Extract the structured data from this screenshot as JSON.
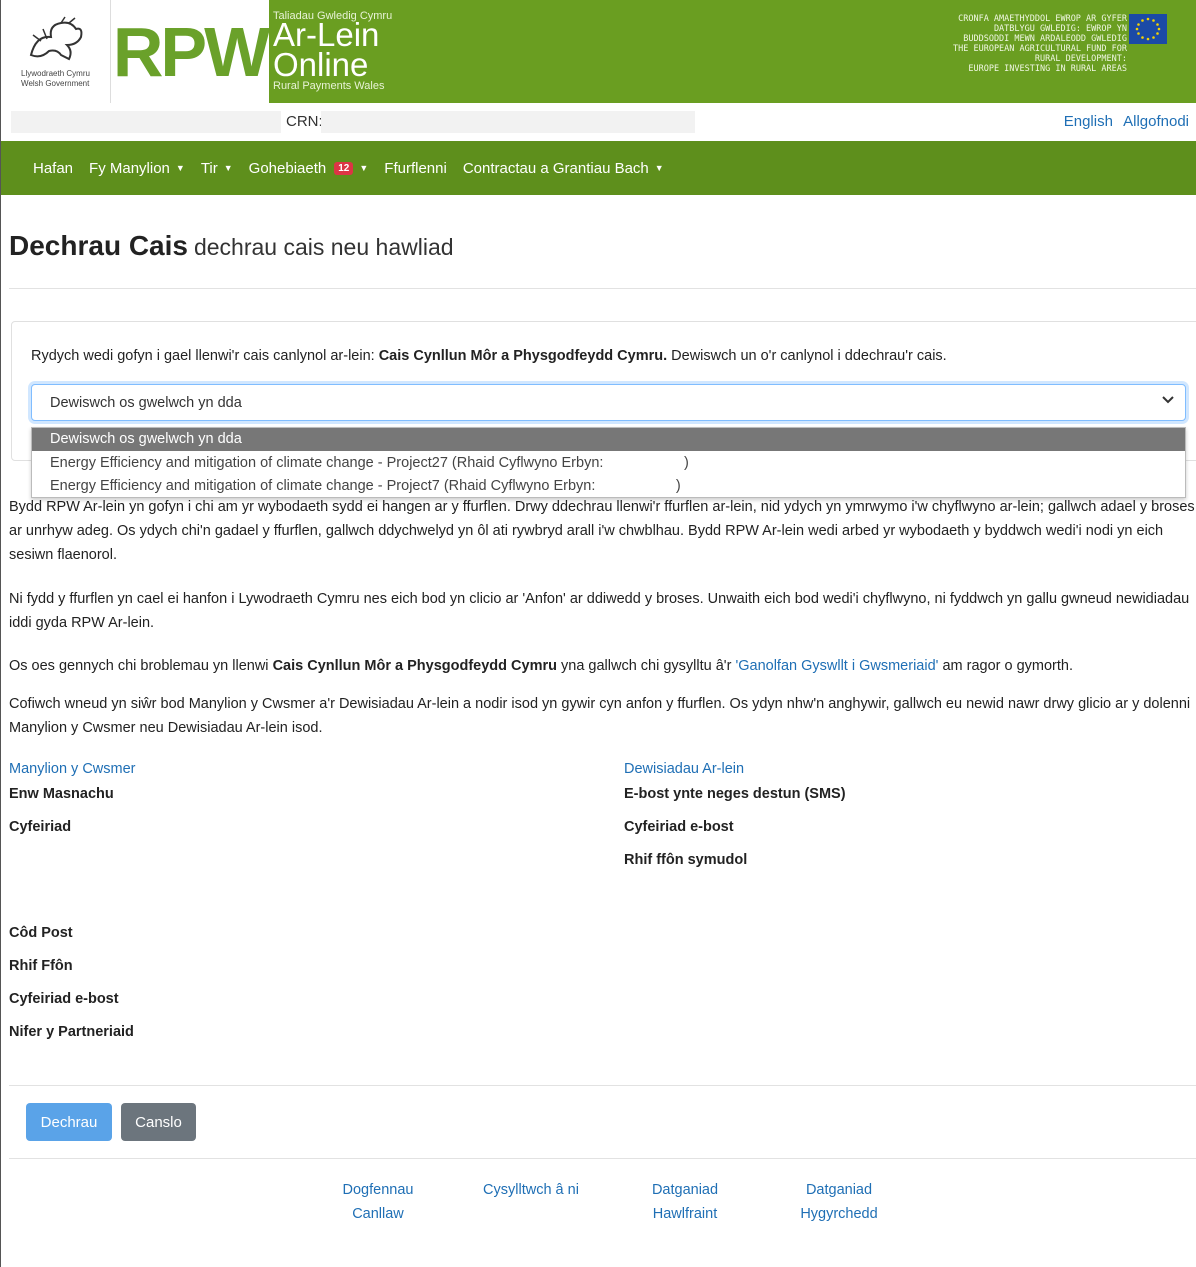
{
  "header": {
    "gov_line1": "Llywodraeth Cymru",
    "gov_line2": "Welsh Government",
    "rpw": "RPW",
    "arlein_small": "Taliadau Gwledig Cymru",
    "arlein_line1": "Ar-Lein",
    "arlein_line2": "Online",
    "arlein_sub": "Rural Payments Wales",
    "eu_text": [
      "CRONFA AMAETHYDDOL EWROP AR GYFER",
      "DATBLYGU GWLEDIG: EWROP YN",
      "BUDDSODDI MEWN ARDALEODD GWLEDIG",
      "THE EUROPEAN AGRICULTURAL FUND FOR",
      "RURAL DEVELOPMENT:",
      "EUROPE INVESTING IN RURAL AREAS"
    ]
  },
  "crn": {
    "label": "CRN:"
  },
  "top_links": {
    "english": "English",
    "logout": "Allgofnodi"
  },
  "nav": {
    "home": "Hafan",
    "my_details": "Fy Manylion",
    "land": "Tir",
    "correspondence": "Gohebiaeth",
    "correspondence_count": "12",
    "forms": "Ffurflenni",
    "contracts": "Contractau a Grantiau Bach"
  },
  "title": {
    "main": "Dechrau Cais",
    "sub": "dechrau cais neu hawliad"
  },
  "panel": {
    "intro_before": "Rydych wedi gofyn i gael llenwi'r cais canlynol ar-lein: ",
    "intro_bold": "Cais Cynllun Môr a Physgodfeydd Cymru.",
    "intro_after": " Dewiswch un o'r canlynol i ddechrau'r cais.",
    "select_value": "Dewiswch os gwelwch yn dda",
    "options": [
      "Dewiswch os gwelwch yn dda",
      "Energy Efficiency and mitigation of climate change - Project27 (Rhaid Cyflwyno Erbyn:                    )",
      "Energy Efficiency and mitigation of climate change - Project7 (Rhaid Cyflwyno Erbyn:                    )"
    ]
  },
  "paragraphs": {
    "p1": "Bydd RPW Ar-lein yn gofyn i chi am yr wybodaeth sydd ei hangen ar y ffurflen. Drwy ddechrau llenwi'r ffurflen ar-lein, nid ydych yn ymrwymo i'w chyflwyno ar-lein; gallwch adael y broses ar unrhyw adeg. Os ydych chi'n gadael y ffurflen, gallwch ddychwelyd yn ôl ati rywbryd arall i'w chwblhau. Bydd RPW Ar-lein wedi arbed yr wybodaeth y byddwch wedi'i nodi yn eich sesiwn flaenorol.",
    "p2": "Ni fydd y ffurflen yn cael ei hanfon i Lywodraeth Cymru nes eich bod yn clicio ar 'Anfon' ar ddiwedd y broses. Unwaith eich bod wedi'i chyflwyno, ni fyddwch yn gallu gwneud newidiadau iddi gyda RPW Ar-lein.",
    "p3_before": "Os oes gennych chi broblemau yn llenwi ",
    "p3_bold": "Cais Cynllun Môr a Physgodfeydd Cymru",
    "p3_middle": " yna gallwch chi gysylltu â'r ",
    "p3_link": "'Ganolfan Gyswllt i Gwsmeriaid'",
    "p3_after": " am ragor o gymorth.",
    "p4": "Cofiwch wneud yn siŵr bod Manylion y Cwsmer a'r Dewisiadau Ar-lein a nodir isod yn gywir cyn anfon y ffurflen. Os ydyn nhw'n anghywir, gallwch eu newid nawr drwy glicio ar y dolenni Manylion y Cwsmer neu Dewisiadau Ar-lein isod."
  },
  "customer": {
    "heading": "Manylion y Cwsmer",
    "trading_name": "Enw Masnachu",
    "address": "Cyfeiriad",
    "postcode": "Côd Post",
    "phone": "Rhif Ffôn",
    "email": "Cyfeiriad e-bost",
    "partners": "Nifer y Partneriaid"
  },
  "online": {
    "heading": "Dewisiadau Ar-lein",
    "email_or_sms": "E-bost ynte neges destun (SMS)",
    "email": "Cyfeiriad e-bost",
    "mobile": "Rhif ffôn symudol"
  },
  "buttons": {
    "start": "Dechrau",
    "cancel": "Canslo"
  },
  "footer": {
    "guidance_1": "Dogfennau",
    "guidance_2": "Canllaw",
    "contact": "Cysylltwch â ni",
    "copyright_1": "Datganiad",
    "copyright_2": "Hawlfraint",
    "accessibility_1": "Datganiad",
    "accessibility_2": "Hygyrchedd"
  },
  "colors": {
    "banner_green": "#6a9e21",
    "nav_green": "#5e8f1c",
    "link_blue": "#1f6fb5",
    "primary_button": "#5aa3e8"
  }
}
